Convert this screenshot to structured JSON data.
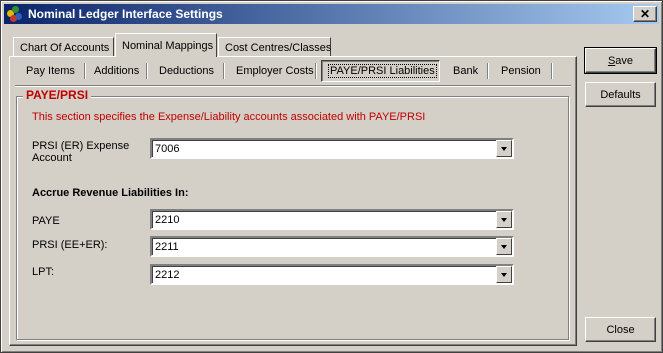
{
  "window": {
    "title": "Nominal Ledger Interface Settings",
    "close_glyph": "✕"
  },
  "tabs": [
    {
      "label": "Chart Of Accounts"
    },
    {
      "label": "Nominal Mappings"
    },
    {
      "label": "Cost Centres/Classes"
    }
  ],
  "subtabs": [
    {
      "label": "Pay Items"
    },
    {
      "label": "Additions"
    },
    {
      "label": "Deductions"
    },
    {
      "label": "Employer Costs"
    },
    {
      "label": "PAYE/PRSI Liabilities"
    },
    {
      "label": "Bank"
    },
    {
      "label": "Pension"
    }
  ],
  "group": {
    "title": "PAYE/PRSI",
    "description": "This section specifies the Expense/Liability accounts associated with PAYE/PRSI",
    "expense_label_line1": "PRSI (ER) Expense",
    "expense_label_line2": "Account",
    "expense_value": "7006",
    "accrue_heading": "Accrue Revenue Liabilities In:",
    "paye_label": "PAYE",
    "paye_value": "2210",
    "prsi_label": "PRSI (EE+ER):",
    "prsi_value": "2211",
    "lpt_label": "LPT:",
    "lpt_value": "2212"
  },
  "buttons": {
    "save_first": "S",
    "save_rest": "ave",
    "defaults": "Defaults",
    "close": "Close"
  },
  "colors": {
    "accent_red": "#c00000",
    "title_blue": "#0a246a"
  }
}
